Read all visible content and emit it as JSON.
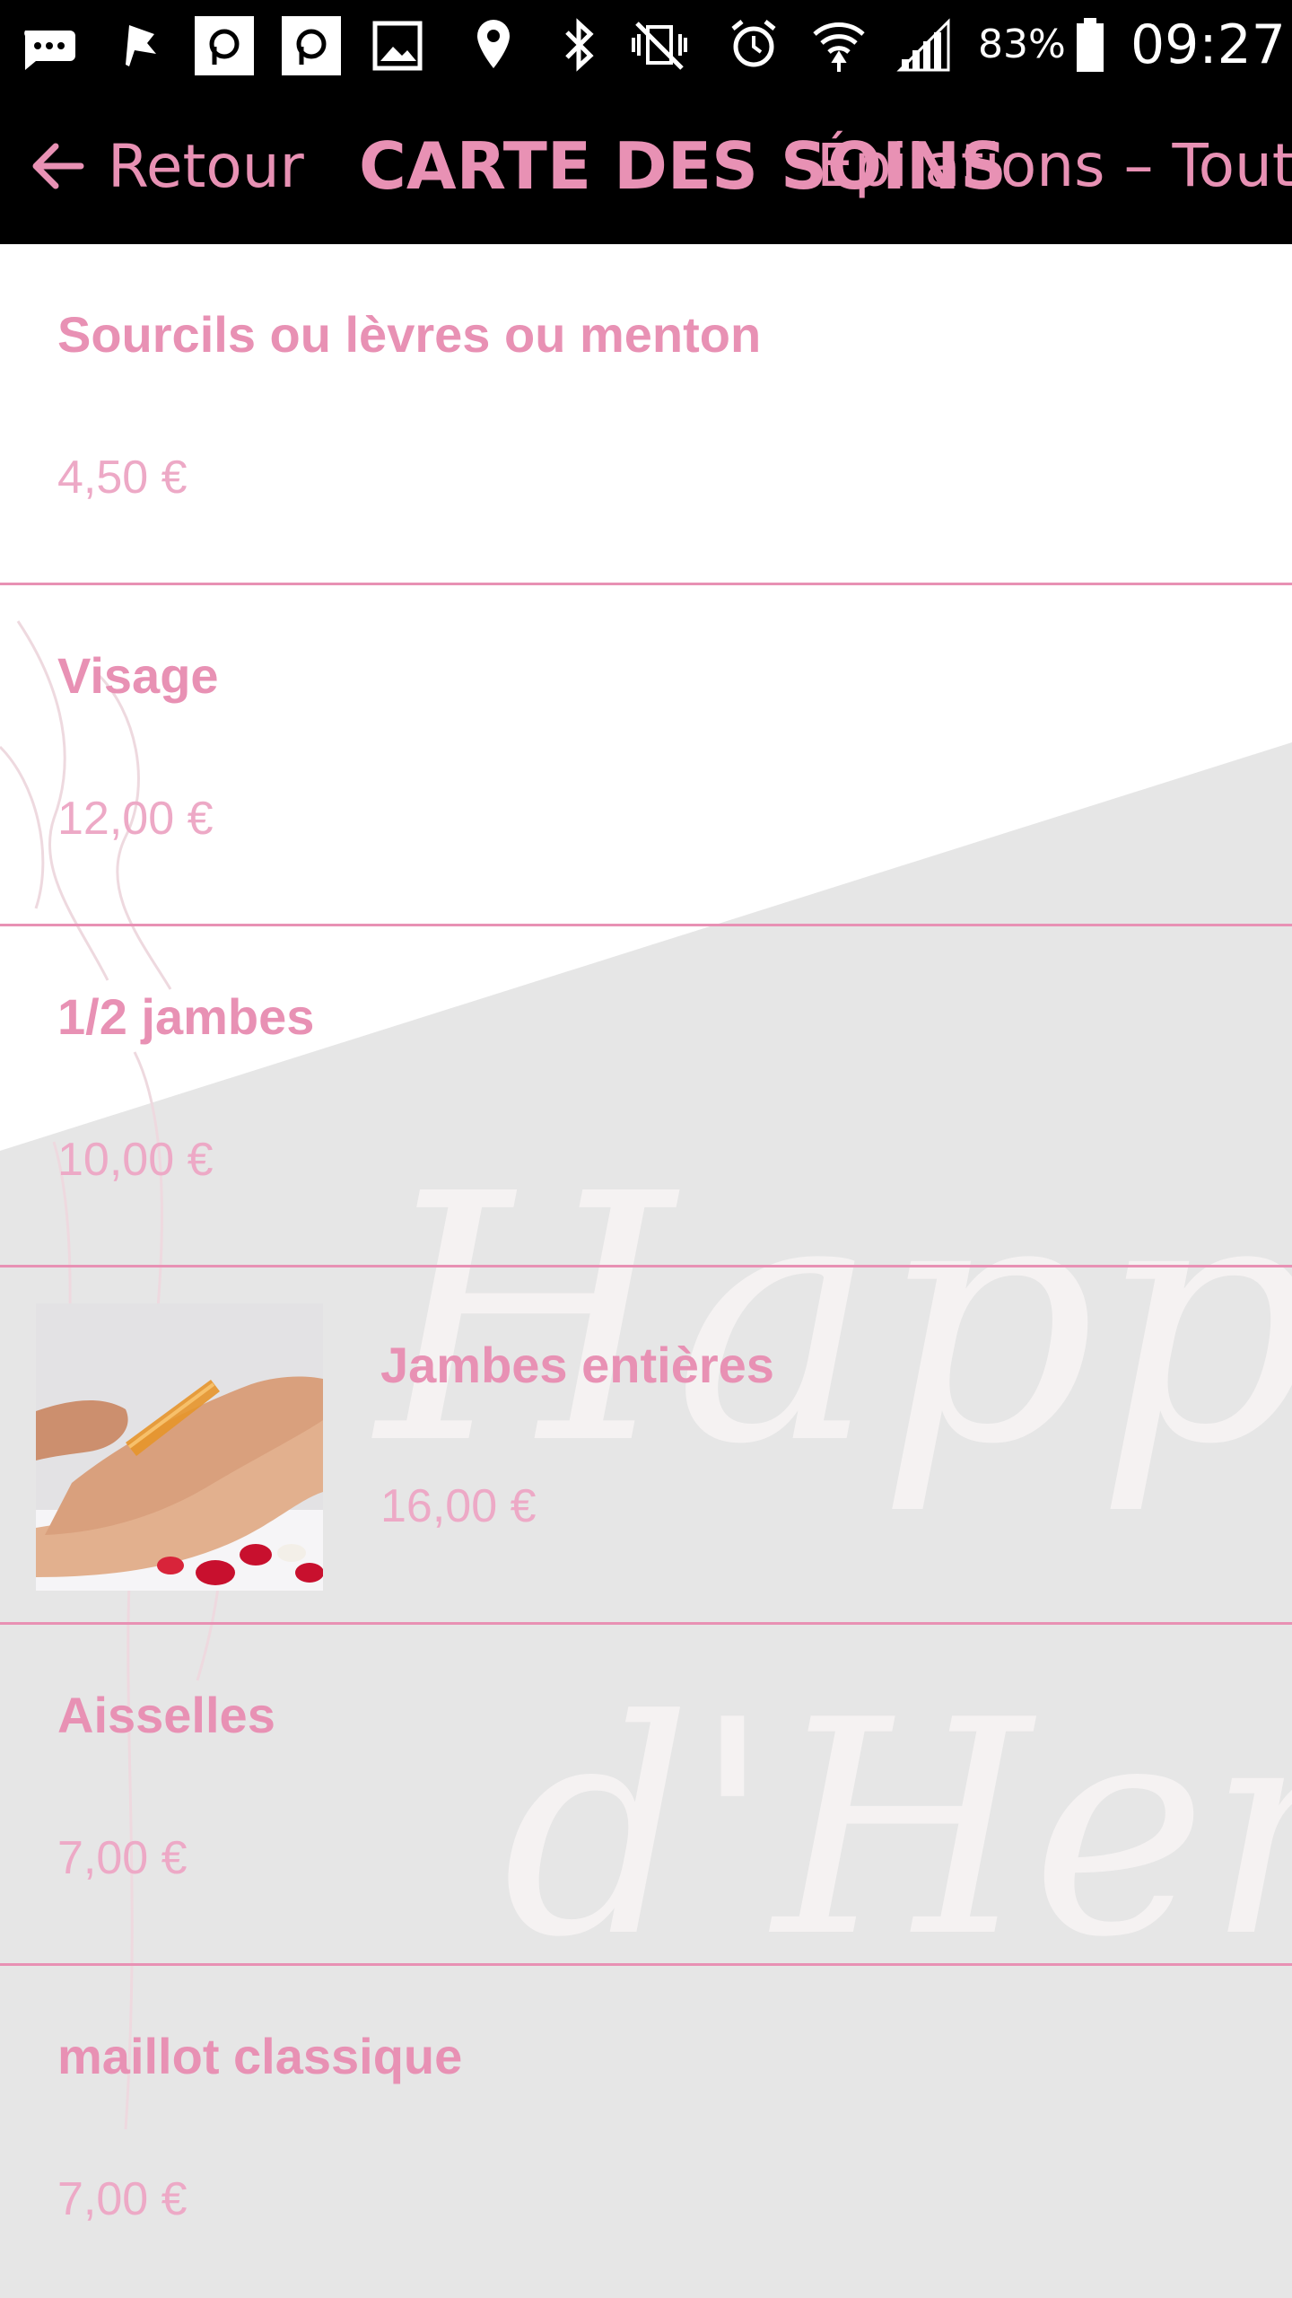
{
  "status_bar": {
    "battery_percent": "83%",
    "time": "09:27",
    "icons": [
      "messenger-icon",
      "flag-icon",
      "p-app-icon",
      "p-app-icon",
      "gallery-icon",
      "location-icon",
      "bluetooth-icon",
      "vibrate-mute-icon",
      "alarm-icon",
      "wifi-icon",
      "signal-icon",
      "battery-icon"
    ]
  },
  "app_bar": {
    "back_label": "Retour",
    "title": "CARTE DES SOINS",
    "subtitle": "Épilations – Tout",
    "accent_color": "#e891b4"
  },
  "watermark": {
    "line1": "Happy",
    "line2": "d'Herm"
  },
  "services": [
    {
      "name": "Sourcils ou lèvres ou menton",
      "price": "4,50 €"
    },
    {
      "name": "Visage",
      "price": "12,00 €"
    },
    {
      "name": "1/2 jambes",
      "price": "10,00 €"
    },
    {
      "name": "Jambes entières",
      "price": "16,00 €",
      "image": "leg-waxing-photo"
    },
    {
      "name": "Aisselles",
      "price": "7,00 €"
    },
    {
      "name": "maillot classique",
      "price": "7,00 €"
    }
  ]
}
